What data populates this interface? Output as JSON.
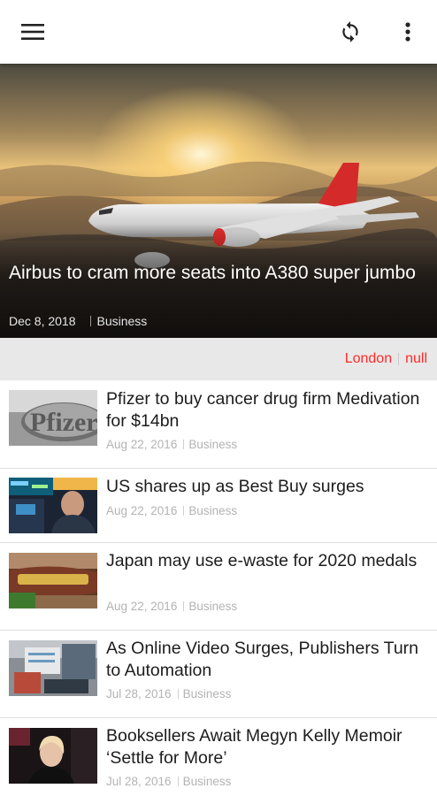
{
  "appbar": {
    "menu_icon": "hamburger-menu-icon",
    "refresh_icon": "refresh-icon",
    "more_icon": "more-vert-icon"
  },
  "hero": {
    "title": "Airbus to cram more seats into A380 super jumbo",
    "date": "Dec 8, 2018",
    "category": "Business",
    "image": "airplane-sunset-photo"
  },
  "location": {
    "city": "London",
    "value": "null",
    "color": "#ff2a2a"
  },
  "articles": [
    {
      "title": "Pfizer to buy cancer drug firm Medivation for $14bn",
      "date": "Aug 22, 2016",
      "category": "Business",
      "image": "pfizer-sign-photo"
    },
    {
      "title": "US shares up as Best Buy surges",
      "date": "Aug 22, 2016",
      "category": "Business",
      "image": "stock-trader-photo"
    },
    {
      "title": "Japan may use e-waste for 2020 medals",
      "date": "Aug 22, 2016",
      "category": "Business",
      "image": "gold-teeth-medal-photo"
    },
    {
      "title": "As Online Video Surges, Publishers Turn to Automation",
      "date": "Jul 28, 2016",
      "category": "Business",
      "image": "circuit-board-photo"
    },
    {
      "title": "Booksellers Await Megyn Kelly Memoir ‘Settle for More’",
      "date": "Jul 28, 2016",
      "category": "Business",
      "image": "megyn-kelly-photo"
    }
  ]
}
